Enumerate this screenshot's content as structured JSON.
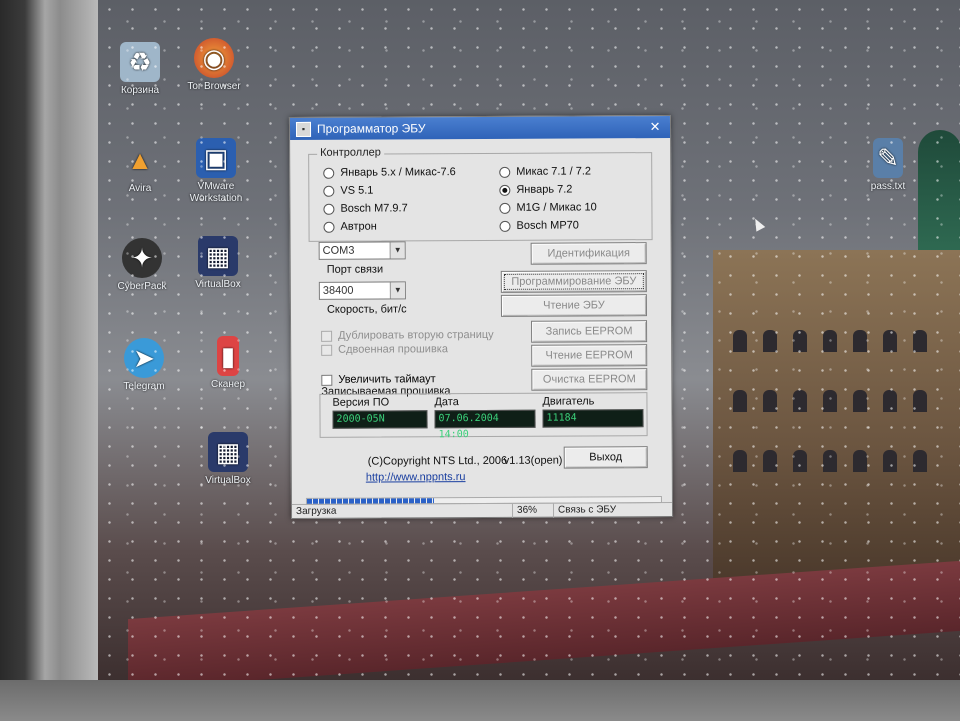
{
  "desktop": {
    "icons": [
      {
        "label": "Корзина",
        "icon": "recycle-bin-icon"
      },
      {
        "label": "Tor Browser",
        "icon": "firefox-icon"
      },
      {
        "label": "Avira",
        "icon": "warning-icon"
      },
      {
        "label": "VMware Workstation",
        "icon": "vmware-icon"
      },
      {
        "label": "CyberPack",
        "icon": "cyberpack-icon"
      },
      {
        "label": "VirtualBox",
        "icon": "virtualbox-icon"
      },
      {
        "label": "Telegram",
        "icon": "telegram-icon"
      },
      {
        "label": "Сканер",
        "icon": "scanner-icon"
      },
      {
        "label": "VirtualBox",
        "icon": "virtualbox-icon"
      },
      {
        "label": "pass.txt",
        "icon": "text-file-icon"
      }
    ]
  },
  "dialog": {
    "title": "Программатор ЭБУ",
    "close_glyph": "✕",
    "controller_group": {
      "label": "Контроллер",
      "options": [
        {
          "label": "Январь 5.x / Микас-7.6",
          "selected": false
        },
        {
          "label": "VS 5.1",
          "selected": false
        },
        {
          "label": "Bosch M7.9.7",
          "selected": false
        },
        {
          "label": "Автрон",
          "selected": false
        },
        {
          "label": "Микас 7.1 / 7.2",
          "selected": false
        },
        {
          "label": "Январь 7.2",
          "selected": true
        },
        {
          "label": "M1G / Микас 10",
          "selected": false
        },
        {
          "label": "Bosch MP70",
          "selected": false
        }
      ]
    },
    "port": {
      "value": "COM3",
      "label": "Порт связи"
    },
    "speed": {
      "value": "38400",
      "label": "Скорость, бит/с"
    },
    "buttons": {
      "identify": "Идентификация",
      "program": "Программирование ЭБУ",
      "read_ecu": "Чтение ЭБУ",
      "write_eeprom": "Запись EEPROM",
      "read_eeprom": "Чтение EEPROM",
      "clear_eeprom": "Очистка EEPROM",
      "exit": "Выход"
    },
    "checks": {
      "duplicate_page": "Дублировать вторую страницу",
      "double_flash": "Сдвоенная прошивка",
      "increase_timeout": "Увеличить таймаут"
    },
    "flash_group": {
      "label": "Записываемая прошивка",
      "version_label": "Версия ПО",
      "version_value": "2000-05N",
      "date_label": "Дата",
      "date_value": "07.06.2004 14:00",
      "engine_label": "Двигатель",
      "engine_value": "11184"
    },
    "copyright": "(C)Copyright NTS Ltd., 2006",
    "version": "v1.13(open)",
    "link": "http://www.nppnts.ru",
    "progress_percent": 36,
    "status": {
      "state": "Загрузка",
      "percent_text": "36%",
      "connection": "Связь с ЭБУ"
    }
  }
}
